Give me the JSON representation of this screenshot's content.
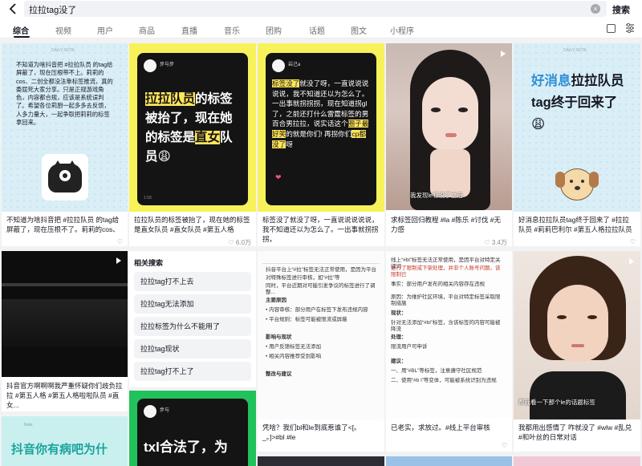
{
  "search": {
    "query": "拉拉tag没了",
    "button": "搜索"
  },
  "tabs": [
    "综合",
    "视频",
    "用户",
    "商品",
    "直播",
    "音乐",
    "团购",
    "话题",
    "图文",
    "小程序"
  ],
  "cards": {
    "c1": {
      "caption": "不知道为啥抖音把 #拉拉队员 的tag给屏蔽了，现在压根不了。莉莉的cos、",
      "note_text": "不知道为啥抖音把 #拉拉队员 的tag给屏蔽了，现在压根带不上。莉莉的cos、二创全都没法靠标签推流，真的委屈死大家分享。只是正规游戏角色，内容都合规，应该是系统误判了。希望各位莉厨一起多多去反馈，人多力量大，一起争取把莉莉的标签拿回来。",
      "badge": "DAILY NOTE"
    },
    "c2": {
      "caption": "拉拉队员的标签被抬了，现在她的标签是直女队员 #直女队员 #第五人格",
      "author": "步与步",
      "big_text": "拉拉队员的标签被抬了，现在她的标签是直女队员😩",
      "likes": "6.0万"
    },
    "c3": {
      "caption": "标签没了就没了呀，一直说说说说说，我不知道还以为怎么了。一出事就拐拐拐，",
      "author": "岩己a",
      "big_text": "标签没了就没了呀，一直说说说说说，我不知道还以为怎么了。一出事就拐拐拐，现在知道拐gl了，之前还打什么雷霆标签的男百合男拉拉，说实话这个圈子最好笑的就是你们! 再拐你们cp都没了呀",
      "heart": "❤"
    },
    "c4": {
      "caption": "求标签回归教程 #la #陈乐 #讨伐 #无力感",
      "video_caption": "我发现le标没了之后",
      "likes": "3.4万"
    },
    "c5": {
      "caption": "好消息拉拉队员tag终于回来了 #拉拉队员 #莉莉巴利尔 #第五人格拉拉队员",
      "badge": "DAILY NOTE",
      "big_text": "好消息拉拉队员tag终于回来了😩"
    },
    "c6": {
      "caption": "抖音官方啊啊啊我严重怀疑你们歧负拉拉 #第五人格 #第五人格啦啦队员 #直女..."
    },
    "c7": {
      "title": "相关搜索",
      "items": [
        "拉拉tag打不上去",
        "拉拉tag无法添加",
        "拉拉标签为什么不能用了",
        "拉拉tag现状",
        "拉拉tag打不上了"
      ],
      "author": "步与",
      "big_text": "txl合法了，为"
    },
    "c8": {
      "caption": "凭啥？我们bl和le到底惹谁了<[。_。]>#bl #le",
      "lines": [
        "抖音平台上“#拉”标签无法正常使用，是因为平台",
        "对特殊标签进行审核，如“#拉”等",
        "同时，平台近期对可能引发争议的标签进行了调整...",
        "主要原因",
        "• 内容审核：部分用户在标签下发布违规内容",
        "• 平台规则：标签可能被限流或屏蔽",
        "影响与现状",
        "• 用户反馈标签无法添加",
        "• 相关内容推荐受到影响",
        "整改与建议"
      ]
    },
    "c9": {
      "caption": "已老实，求放过。#线上平台审核",
      "lines": [
        "线上“#bl”标签无法正常使用，是因平台对特定关键词",
        "进行了限制或下架处理，并非个人账号问题，该限制已",
        "事实：部分用户发布的相关内容存在违规",
        "原因：为维护社区环境，平台对特定标签采取限制措施",
        "现状：",
        "针对无法添加“#bl”标签，含该标签的内容可能被降流",
        "处理：",
        "限流用户可申诉",
        "建议：",
        "一、用“#BL”等标签，注意遵守社区规范",
        "二、使用“#b l”等变体，可能被系统识别为违规"
      ]
    },
    "c10": {
      "caption": "我都用出感情了 咋就没了 #wlw #乱兑 #和叶丝的日常对话",
      "video_caption": "帮我看一下那个le的话题标签"
    },
    "c11": {
      "big_text": "抖音你有病吧为什"
    }
  }
}
